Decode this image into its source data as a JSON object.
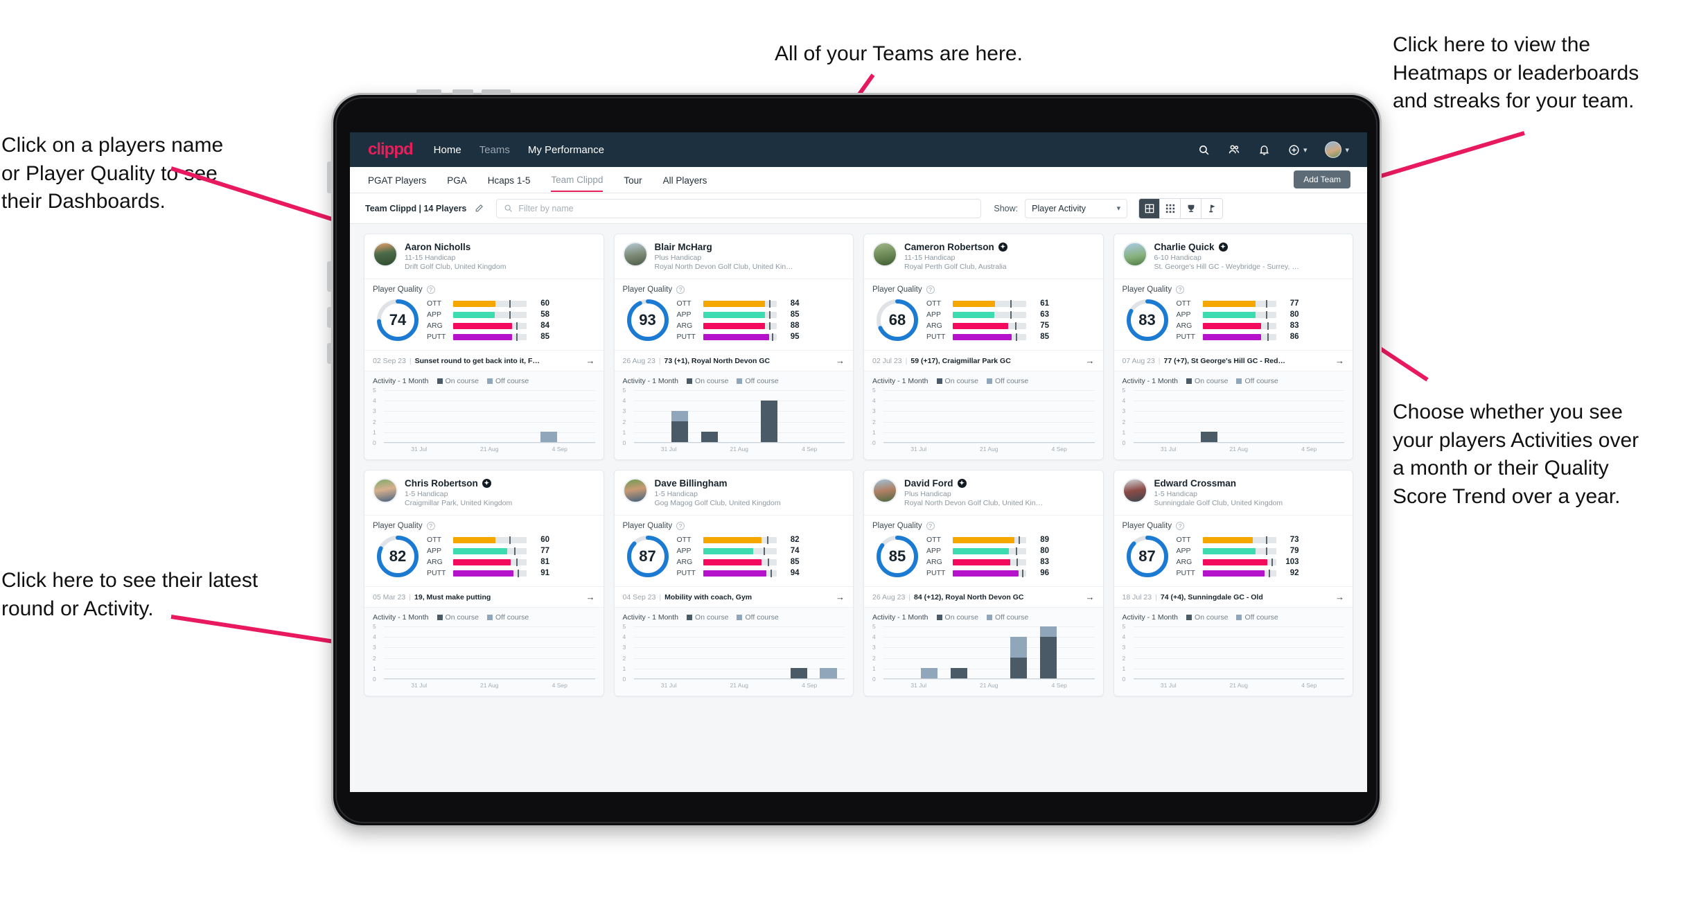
{
  "annotations": {
    "top_left": "Click on a players name\nor Player Quality to see\ntheir Dashboards.",
    "top_center": "All of your Teams are here.",
    "top_right": "Click here to view the\nHeatmaps or leaderboards\nand streaks for your team.",
    "right_middle": "Choose whether you see\nyour players Activities over\na month or their Quality\nScore Trend over a year.",
    "bottom_left": "Click here to see their latest\nround or Activity.",
    "arrow_color": "#e8195f"
  },
  "navbar": {
    "logo": "clippd",
    "links": [
      {
        "label": "Home",
        "active": true
      },
      {
        "label": "Teams",
        "active": false
      },
      {
        "label": "My Performance",
        "active": true
      }
    ],
    "icons": [
      "search-icon",
      "people-icon",
      "bell-icon",
      "plus-circle-icon",
      "avatar"
    ]
  },
  "team_tabs": {
    "items": [
      {
        "label": "PGAT Players",
        "selected": false
      },
      {
        "label": "PGA",
        "selected": false
      },
      {
        "label": "Hcaps 1-5",
        "selected": false
      },
      {
        "label": "Team Clippd",
        "selected": true
      },
      {
        "label": "Tour",
        "selected": false
      },
      {
        "label": "All Players",
        "selected": false
      }
    ],
    "add_team_label": "Add Team"
  },
  "toolbar": {
    "team_label": "Team Clippd | 14 Players",
    "edit_icon": "pencil-icon",
    "search_placeholder": "Filter by name",
    "show_label": "Show:",
    "show_value": "Player Activity",
    "view_toggles": [
      {
        "name": "grid-view-icon",
        "active": true
      },
      {
        "name": "dense-grid-view-icon",
        "active": false
      },
      {
        "name": "trophy-view-icon",
        "active": false
      },
      {
        "name": "flag-pin-view-icon",
        "active": false
      }
    ]
  },
  "legend": {
    "on_course": "On course",
    "off_course": "Off course"
  },
  "labels": {
    "player_quality": "Player Quality",
    "activity": "Activity - 1 Month"
  },
  "colors": {
    "ott": "#f5a700",
    "app": "#3ddbb0",
    "arg": "#f40a5c",
    "putt": "#b412cb",
    "ring": "#1b7ad1",
    "ring_track": "#dfe3e7",
    "accent": "#e81e5a",
    "navbar": "#1c3040",
    "on_course": "#4a5a66",
    "off_course": "#8fa6bb"
  },
  "chart_data": {
    "type": "bar",
    "title": "Activity - 1 Month",
    "ylabel": "",
    "xlabel": "",
    "ylim": [
      0,
      5
    ],
    "yticks": [
      5,
      4,
      3,
      2,
      1,
      0
    ],
    "xticks": [
      "31 Jul",
      "21 Aug",
      "4 Sep"
    ],
    "grid": true,
    "legend": [
      "On course",
      "Off course"
    ],
    "legend_position": "top-right",
    "panels": [
      {
        "player": "Aaron Nicholls",
        "series": [
          {
            "name": "On course",
            "values": [
              0,
              0,
              0,
              0,
              0,
              0,
              0
            ]
          },
          {
            "name": "Off course",
            "values": [
              0,
              0,
              0,
              0,
              0,
              1,
              0
            ]
          }
        ]
      },
      {
        "player": "Blair McHarg",
        "series": [
          {
            "name": "On course",
            "values": [
              0,
              2,
              1,
              0,
              4,
              0,
              0
            ]
          },
          {
            "name": "Off course",
            "values": [
              0,
              1,
              0,
              0,
              0,
              0,
              0
            ]
          }
        ]
      },
      {
        "player": "Cameron Robertson",
        "series": [
          {
            "name": "On course",
            "values": [
              0,
              0,
              0,
              0,
              0,
              0,
              0
            ]
          },
          {
            "name": "Off course",
            "values": [
              0,
              0,
              0,
              0,
              0,
              0,
              0
            ]
          }
        ]
      },
      {
        "player": "Charlie Quick",
        "series": [
          {
            "name": "On course",
            "values": [
              0,
              0,
              1,
              0,
              0,
              0,
              0
            ]
          },
          {
            "name": "Off course",
            "values": [
              0,
              0,
              0,
              0,
              0,
              0,
              0
            ]
          }
        ]
      },
      {
        "player": "Chris Robertson",
        "series": [
          {
            "name": "On course",
            "values": [
              0,
              0,
              0,
              0,
              0,
              0,
              0
            ]
          },
          {
            "name": "Off course",
            "values": [
              0,
              0,
              0,
              0,
              0,
              0,
              0
            ]
          }
        ]
      },
      {
        "player": "Dave Billingham",
        "series": [
          {
            "name": "On course",
            "values": [
              0,
              0,
              0,
              0,
              0,
              1,
              0
            ]
          },
          {
            "name": "Off course",
            "values": [
              0,
              0,
              0,
              0,
              0,
              0,
              1
            ]
          }
        ]
      },
      {
        "player": "David Ford",
        "series": [
          {
            "name": "On course",
            "values": [
              0,
              0,
              1,
              0,
              2,
              4,
              0
            ]
          },
          {
            "name": "Off course",
            "values": [
              0,
              1,
              0,
              0,
              2,
              1,
              0
            ]
          }
        ]
      },
      {
        "player": "Edward Crossman",
        "series": [
          {
            "name": "On course",
            "values": [
              0,
              0,
              0,
              0,
              0,
              0,
              0
            ]
          },
          {
            "name": "Off course",
            "values": [
              0,
              0,
              0,
              0,
              0,
              0,
              0
            ]
          }
        ]
      }
    ]
  },
  "players": [
    {
      "name": "Aaron Nicholls",
      "verified": false,
      "handicap": "11-15 Handicap",
      "club": "Drift Golf Club, United Kingdom",
      "quality_score": 74,
      "metrics": [
        {
          "key": "OTT",
          "value": 60,
          "fill_pct": 58,
          "tick_pct": 76
        },
        {
          "key": "APP",
          "value": 58,
          "fill_pct": 57,
          "tick_pct": 76
        },
        {
          "key": "ARG",
          "value": 84,
          "fill_pct": 80,
          "tick_pct": 86
        },
        {
          "key": "PUTT",
          "value": 85,
          "fill_pct": 80,
          "tick_pct": 86
        }
      ],
      "last_date": "02 Sep 23",
      "last_text": "Sunset round to get back into it, F…"
    },
    {
      "name": "Blair McHarg",
      "verified": false,
      "handicap": "Plus Handicap",
      "club": "Royal North Devon Golf Club, United Kin…",
      "quality_score": 93,
      "metrics": [
        {
          "key": "OTT",
          "value": 84,
          "fill_pct": 84,
          "tick_pct": 90
        },
        {
          "key": "APP",
          "value": 85,
          "fill_pct": 84,
          "tick_pct": 90
        },
        {
          "key": "ARG",
          "value": 88,
          "fill_pct": 84,
          "tick_pct": 90
        },
        {
          "key": "PUTT",
          "value": 95,
          "fill_pct": 90,
          "tick_pct": 94
        }
      ],
      "last_date": "26 Aug 23",
      "last_text": "73 (+1), Royal North Devon GC"
    },
    {
      "name": "Cameron Robertson",
      "verified": true,
      "handicap": "11-15 Handicap",
      "club": "Royal Perth Golf Club, Australia",
      "quality_score": 68,
      "metrics": [
        {
          "key": "OTT",
          "value": 61,
          "fill_pct": 58,
          "tick_pct": 78
        },
        {
          "key": "APP",
          "value": 63,
          "fill_pct": 57,
          "tick_pct": 78
        },
        {
          "key": "ARG",
          "value": 75,
          "fill_pct": 75,
          "tick_pct": 85
        },
        {
          "key": "PUTT",
          "value": 85,
          "fill_pct": 80,
          "tick_pct": 86
        }
      ],
      "last_date": "02 Jul 23",
      "last_text": "59 (+17), Craigmillar Park GC"
    },
    {
      "name": "Charlie Quick",
      "verified": true,
      "handicap": "6-10 Handicap",
      "club": "St. George's Hill GC - Weybridge - Surrey, …",
      "quality_score": 83,
      "metrics": [
        {
          "key": "OTT",
          "value": 77,
          "fill_pct": 72,
          "tick_pct": 86
        },
        {
          "key": "APP",
          "value": 80,
          "fill_pct": 72,
          "tick_pct": 86
        },
        {
          "key": "ARG",
          "value": 83,
          "fill_pct": 80,
          "tick_pct": 88
        },
        {
          "key": "PUTT",
          "value": 86,
          "fill_pct": 80,
          "tick_pct": 88
        }
      ],
      "last_date": "07 Aug 23",
      "last_text": "77 (+7), St George's Hill GC - Red…"
    },
    {
      "name": "Chris Robertson",
      "verified": true,
      "handicap": "1-5 Handicap",
      "club": "Craigmillar Park, United Kingdom",
      "quality_score": 82,
      "metrics": [
        {
          "key": "OTT",
          "value": 60,
          "fill_pct": 58,
          "tick_pct": 76
        },
        {
          "key": "APP",
          "value": 77,
          "fill_pct": 74,
          "tick_pct": 83
        },
        {
          "key": "ARG",
          "value": 81,
          "fill_pct": 78,
          "tick_pct": 86
        },
        {
          "key": "PUTT",
          "value": 91,
          "fill_pct": 82,
          "tick_pct": 88
        }
      ],
      "last_date": "05 Mar 23",
      "last_text": "19, Must make putting"
    },
    {
      "name": "Dave Billingham",
      "verified": false,
      "handicap": "1-5 Handicap",
      "club": "Gog Magog Golf Club, United Kingdom",
      "quality_score": 87,
      "metrics": [
        {
          "key": "OTT",
          "value": 82,
          "fill_pct": 80,
          "tick_pct": 87
        },
        {
          "key": "APP",
          "value": 74,
          "fill_pct": 68,
          "tick_pct": 83
        },
        {
          "key": "ARG",
          "value": 85,
          "fill_pct": 80,
          "tick_pct": 88
        },
        {
          "key": "PUTT",
          "value": 94,
          "fill_pct": 86,
          "tick_pct": 92
        }
      ],
      "last_date": "04 Sep 23",
      "last_text": "Mobility with coach, Gym"
    },
    {
      "name": "David Ford",
      "verified": true,
      "handicap": "Plus Handicap",
      "club": "Royal North Devon Golf Club, United Kin…",
      "quality_score": 85,
      "metrics": [
        {
          "key": "OTT",
          "value": 89,
          "fill_pct": 84,
          "tick_pct": 90
        },
        {
          "key": "APP",
          "value": 80,
          "fill_pct": 76,
          "tick_pct": 86
        },
        {
          "key": "ARG",
          "value": 83,
          "fill_pct": 78,
          "tick_pct": 87
        },
        {
          "key": "PUTT",
          "value": 96,
          "fill_pct": 90,
          "tick_pct": 94
        }
      ],
      "last_date": "26 Aug 23",
      "last_text": "84 (+12), Royal North Devon GC"
    },
    {
      "name": "Edward Crossman",
      "verified": false,
      "handicap": "1-5 Handicap",
      "club": "Sunningdale Golf Club, United Kingdom",
      "quality_score": 87,
      "metrics": [
        {
          "key": "OTT",
          "value": 73,
          "fill_pct": 68,
          "tick_pct": 86
        },
        {
          "key": "APP",
          "value": 79,
          "fill_pct": 72,
          "tick_pct": 86
        },
        {
          "key": "ARG",
          "value": 103,
          "fill_pct": 88,
          "tick_pct": 94
        },
        {
          "key": "PUTT",
          "value": 92,
          "fill_pct": 84,
          "tick_pct": 90
        }
      ],
      "last_date": "18 Jul 23",
      "last_text": "74 (+4), Sunningdale GC - Old"
    }
  ]
}
